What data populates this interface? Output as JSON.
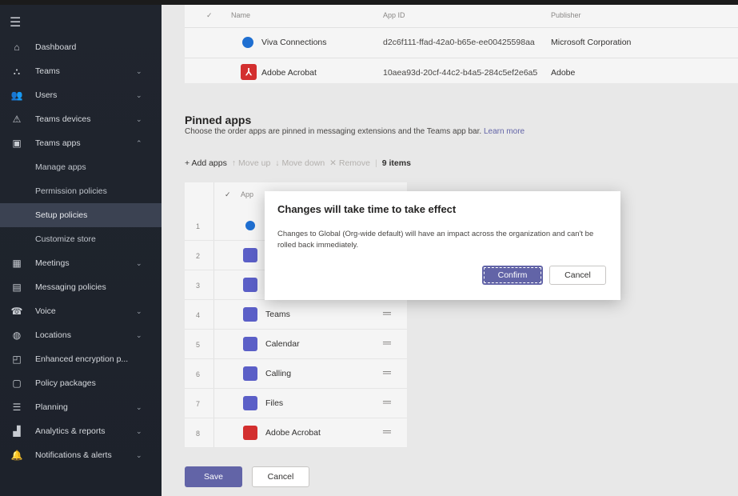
{
  "sidebar": {
    "items": [
      {
        "label": "Dashboard",
        "icon": "home-icon",
        "glyph": "⌂",
        "chevron": ""
      },
      {
        "label": "Teams",
        "icon": "teams-icon",
        "glyph": "⛬",
        "chevron": "⌄"
      },
      {
        "label": "Users",
        "icon": "users-icon",
        "glyph": "👥",
        "chevron": "⌄"
      },
      {
        "label": "Teams devices",
        "icon": "devices-icon",
        "glyph": "⚠",
        "chevron": "⌄"
      },
      {
        "label": "Teams apps",
        "icon": "apps-icon",
        "glyph": "▣",
        "chevron": "⌃"
      },
      {
        "label": "Manage apps",
        "icon": "",
        "glyph": "",
        "chevron": ""
      },
      {
        "label": "Permission policies",
        "icon": "",
        "glyph": "",
        "chevron": ""
      },
      {
        "label": "Setup policies",
        "icon": "",
        "glyph": "",
        "chevron": ""
      },
      {
        "label": "Customize store",
        "icon": "",
        "glyph": "",
        "chevron": ""
      },
      {
        "label": "Meetings",
        "icon": "calendar-icon",
        "glyph": "▦",
        "chevron": "⌄"
      },
      {
        "label": "Messaging policies",
        "icon": "message-icon",
        "glyph": "▤",
        "chevron": ""
      },
      {
        "label": "Voice",
        "icon": "phone-icon",
        "glyph": "☎",
        "chevron": "⌄"
      },
      {
        "label": "Locations",
        "icon": "globe-icon",
        "glyph": "◍",
        "chevron": "⌄"
      },
      {
        "label": "Enhanced encryption p...",
        "icon": "lock-icon",
        "glyph": "◰",
        "chevron": ""
      },
      {
        "label": "Policy packages",
        "icon": "package-icon",
        "glyph": "▢",
        "chevron": ""
      },
      {
        "label": "Planning",
        "icon": "list-icon",
        "glyph": "☰",
        "chevron": "⌄"
      },
      {
        "label": "Analytics & reports",
        "icon": "chart-icon",
        "glyph": "▟",
        "chevron": "⌄"
      },
      {
        "label": "Notifications & alerts",
        "icon": "bell-icon",
        "glyph": "🔔",
        "chevron": "⌄"
      }
    ]
  },
  "top_table": {
    "headers": {
      "name": "Name",
      "app_id": "App ID",
      "publisher": "Publisher"
    },
    "rows": [
      {
        "name": "Viva Connections",
        "app_id": "d2c6f111-ffad-42a0-b65e-ee00425598aa",
        "publisher": "Microsoft Corporation"
      },
      {
        "name": "Adobe Acrobat",
        "app_id": "10aea93d-20cf-44c2-b4a5-284c5ef2e6a5",
        "publisher": "Adobe"
      }
    ]
  },
  "pinned": {
    "title": "Pinned apps",
    "description": "Choose the order apps are pinned in messaging extensions and the Teams app bar.",
    "learn_more": "Learn more",
    "toolbar": {
      "add": "+ Add apps",
      "move_up": "↑ Move up",
      "move_down": "↓ Move down",
      "remove": "✕ Remove",
      "count": "9 items"
    },
    "header_app": "App",
    "rows": [
      {
        "num": "1",
        "name": "",
        "color": "#ffffff"
      },
      {
        "num": "2",
        "name": "",
        "color": "#5b5fc7"
      },
      {
        "num": "3",
        "name": "",
        "color": "#5b5fc7"
      },
      {
        "num": "4",
        "name": "Teams",
        "color": "#5b5fc7"
      },
      {
        "num": "5",
        "name": "Calendar",
        "color": "#5b5fc7"
      },
      {
        "num": "6",
        "name": "Calling",
        "color": "#5b5fc7"
      },
      {
        "num": "7",
        "name": "Files",
        "color": "#5b5fc7"
      },
      {
        "num": "8",
        "name": "Adobe Acrobat",
        "color": "#d32f2f"
      }
    ]
  },
  "footer": {
    "save": "Save",
    "cancel": "Cancel"
  },
  "dialog": {
    "title": "Changes will take time to take effect",
    "body": "Changes to Global (Org-wide default) will have an impact across the organization and can't be rolled back immediately.",
    "confirm": "Confirm",
    "cancel": "Cancel"
  },
  "colors": {
    "accent": "#6264a7",
    "sidebar": "#20252e"
  }
}
